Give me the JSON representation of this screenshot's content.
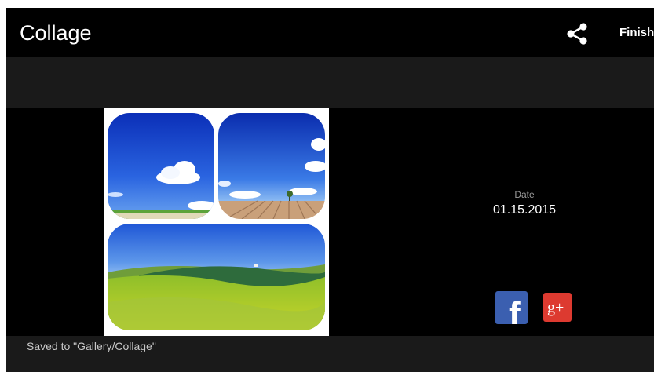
{
  "app": {
    "title": "Collage",
    "finish_label": "Finish"
  },
  "icons": {
    "share": "share-icon",
    "facebook": "facebook-icon",
    "google_plus": "google-plus-icon"
  },
  "collage": {
    "tiles": [
      {
        "name": "sky-with-cloud-photo"
      },
      {
        "name": "plowed-field-sky-photo"
      },
      {
        "name": "green-hills-landscape-photo"
      }
    ]
  },
  "info": {
    "date_label": "Date",
    "date_value": "01.15.2015"
  },
  "social": {
    "facebook_glyph": "f",
    "google_plus_glyph": "g+"
  },
  "status": {
    "message": "Saved to \"Gallery/Collage\""
  },
  "colors": {
    "background": "#000000",
    "bar": "#1a1a1a",
    "facebook": "#3b5fb0",
    "google_plus": "#dd3a30"
  }
}
